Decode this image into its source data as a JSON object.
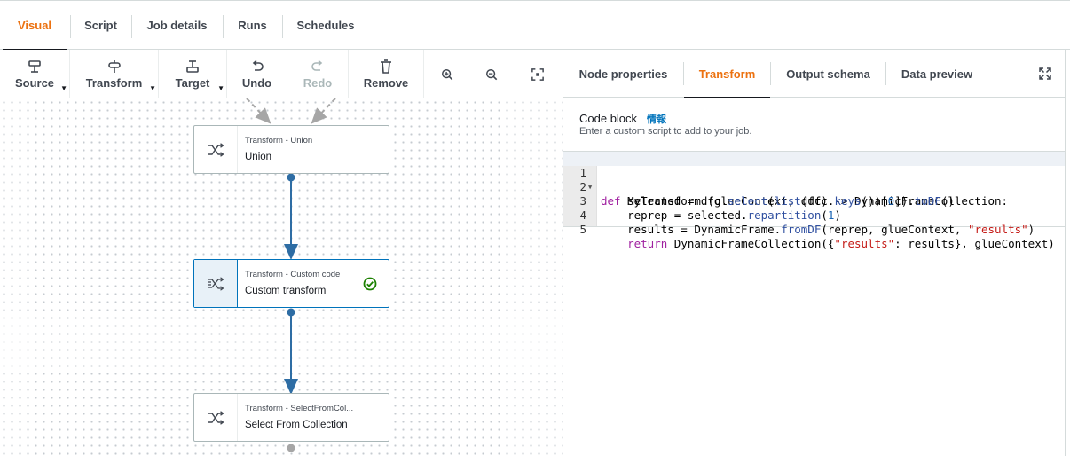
{
  "top_tabs": [
    {
      "label": "Visual",
      "active": true
    },
    {
      "label": "Script",
      "active": false
    },
    {
      "label": "Job details",
      "active": false
    },
    {
      "label": "Runs",
      "active": false
    },
    {
      "label": "Schedules",
      "active": false
    }
  ],
  "toolbar": {
    "source": "Source",
    "transform": "Transform",
    "target": "Target",
    "undo": "Undo",
    "redo": "Redo",
    "remove": "Remove",
    "zoom_in_icon": "zoom-in-icon",
    "zoom_out_icon": "zoom-out-icon",
    "fit_icon": "fit-to-screen-icon"
  },
  "nodes": [
    {
      "type": "Transform - Union",
      "name": "Union",
      "selected": false
    },
    {
      "type": "Transform - Custom code",
      "name": "Custom transform",
      "selected": true,
      "status": "valid"
    },
    {
      "type": "Transform - SelectFromCol...",
      "name": "Select From Collection",
      "selected": false
    }
  ],
  "panel": {
    "tabs": [
      {
        "label": "Node properties",
        "active": false
      },
      {
        "label": "Transform",
        "active": true
      },
      {
        "label": "Output schema",
        "active": false
      },
      {
        "label": "Data preview",
        "active": false
      }
    ],
    "code_block_title": "Code block",
    "info_link": "情報",
    "code_block_desc": "Enter a custom script to add to your job.",
    "code_lines": [
      "def MyTransform (glueContext, dfc) -> DynamicFrameCollection:",
      "    selected = dfc.select(list(dfc.keys())[0]).toDF()",
      "    reprep = selected.repartition(1)",
      "    results = DynamicFrame.fromDF(reprep, glueContext, \"results\")",
      "    return DynamicFrameCollection({\"results\": results}, glueContext)"
    ],
    "line_numbers": [
      "1",
      "2",
      "3",
      "4",
      "5"
    ]
  },
  "colors": {
    "accent_active": "#ec7211",
    "link": "#0073bb",
    "edge": "#2e6da4",
    "success": "#1d8102"
  }
}
